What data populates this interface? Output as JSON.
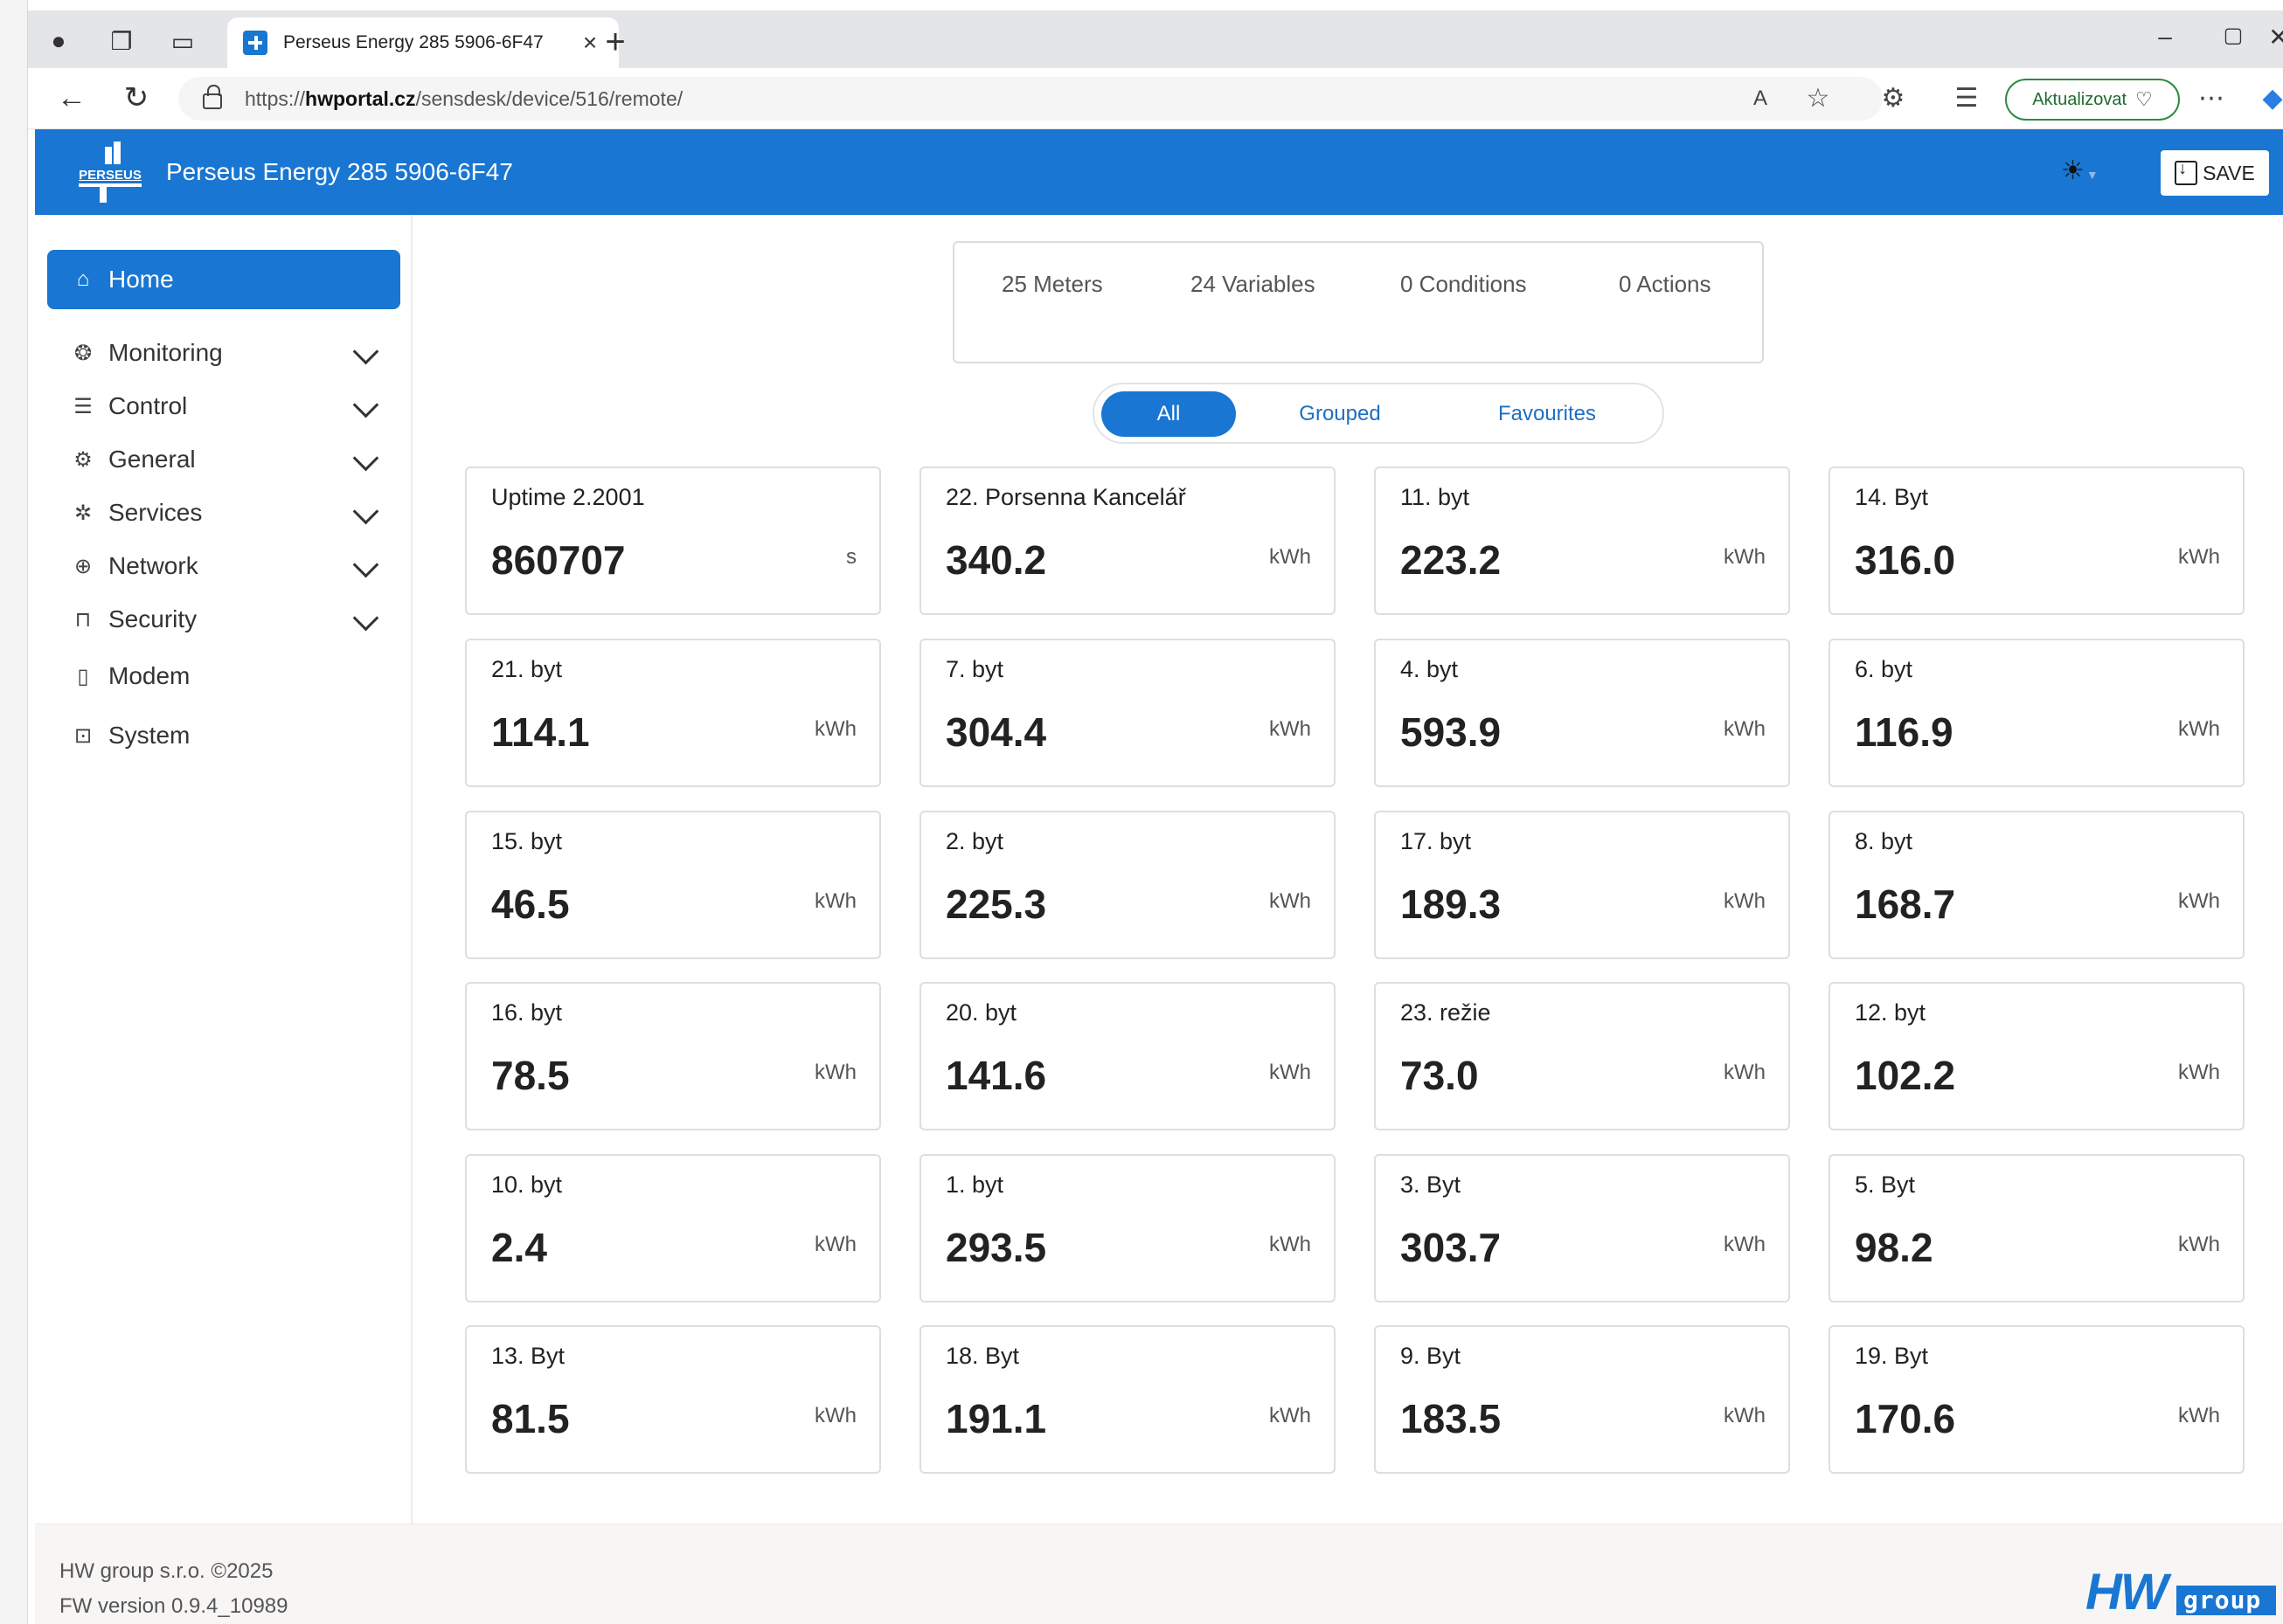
{
  "browser": {
    "tab_title": "Perseus Energy 285 5906-6F47",
    "url_prefix": "https://",
    "url_host": "hwportal.cz",
    "url_path": "/sensdesk/device/516/remote/",
    "update_label": "Aktualizovat"
  },
  "header": {
    "logo_text": "PERSEUS",
    "title": "Perseus Energy 285 5906-6F47",
    "save_label": "SAVE"
  },
  "sidebar": {
    "items": [
      {
        "label": "Home",
        "icon": "home-icon"
      },
      {
        "label": "Monitoring",
        "icon": "monitoring-icon"
      },
      {
        "label": "Control",
        "icon": "sliders-icon"
      },
      {
        "label": "General",
        "icon": "gear-icon"
      },
      {
        "label": "Services",
        "icon": "services-icon"
      },
      {
        "label": "Network",
        "icon": "globe-icon"
      },
      {
        "label": "Security",
        "icon": "lock-icon"
      },
      {
        "label": "Modem",
        "icon": "modem-icon"
      },
      {
        "label": "System",
        "icon": "system-icon"
      }
    ]
  },
  "summary": {
    "meters": "25 Meters",
    "variables": "24 Variables",
    "conditions": "0 Conditions",
    "actions": "0 Actions"
  },
  "filters": [
    "All",
    "Grouped",
    "Favourites"
  ],
  "cards": [
    {
      "title": "Uptime 2.2001",
      "value": "860707",
      "unit": "s"
    },
    {
      "title": "22. Porsenna Kancelář",
      "value": "340.2",
      "unit": "kWh"
    },
    {
      "title": "11. byt",
      "value": "223.2",
      "unit": "kWh"
    },
    {
      "title": "14. Byt",
      "value": "316.0",
      "unit": "kWh"
    },
    {
      "title": "21. byt",
      "value": "114.1",
      "unit": "kWh"
    },
    {
      "title": "7. byt",
      "value": "304.4",
      "unit": "kWh"
    },
    {
      "title": "4. byt",
      "value": "593.9",
      "unit": "kWh"
    },
    {
      "title": "6. byt",
      "value": "116.9",
      "unit": "kWh"
    },
    {
      "title": "15. byt",
      "value": "46.5",
      "unit": "kWh"
    },
    {
      "title": "2. byt",
      "value": "225.3",
      "unit": "kWh"
    },
    {
      "title": "17. byt",
      "value": "189.3",
      "unit": "kWh"
    },
    {
      "title": "8. byt",
      "value": "168.7",
      "unit": "kWh"
    },
    {
      "title": "16. byt",
      "value": "78.5",
      "unit": "kWh"
    },
    {
      "title": "20. byt",
      "value": "141.6",
      "unit": "kWh"
    },
    {
      "title": "23. režie",
      "value": "73.0",
      "unit": "kWh"
    },
    {
      "title": "12. byt",
      "value": "102.2",
      "unit": "kWh"
    },
    {
      "title": "10. byt",
      "value": "2.4",
      "unit": "kWh"
    },
    {
      "title": "1. byt",
      "value": "293.5",
      "unit": "kWh"
    },
    {
      "title": "3. Byt",
      "value": "303.7",
      "unit": "kWh"
    },
    {
      "title": "5. Byt",
      "value": "98.2",
      "unit": "kWh"
    },
    {
      "title": "13. Byt",
      "value": "81.5",
      "unit": "kWh"
    },
    {
      "title": "18. Byt",
      "value": "191.1",
      "unit": "kWh"
    },
    {
      "title": "9. Byt",
      "value": "183.5",
      "unit": "kWh"
    },
    {
      "title": "19. Byt",
      "value": "170.6",
      "unit": "kWh"
    }
  ],
  "footer": {
    "copyright": "HW group s.r.o. ©2025",
    "fw_version": "FW version 0.9.4_10989",
    "logo_hw": "HW",
    "logo_group": "group"
  },
  "colors": {
    "accent": "#1976d2",
    "update_border": "#2f8a43"
  }
}
